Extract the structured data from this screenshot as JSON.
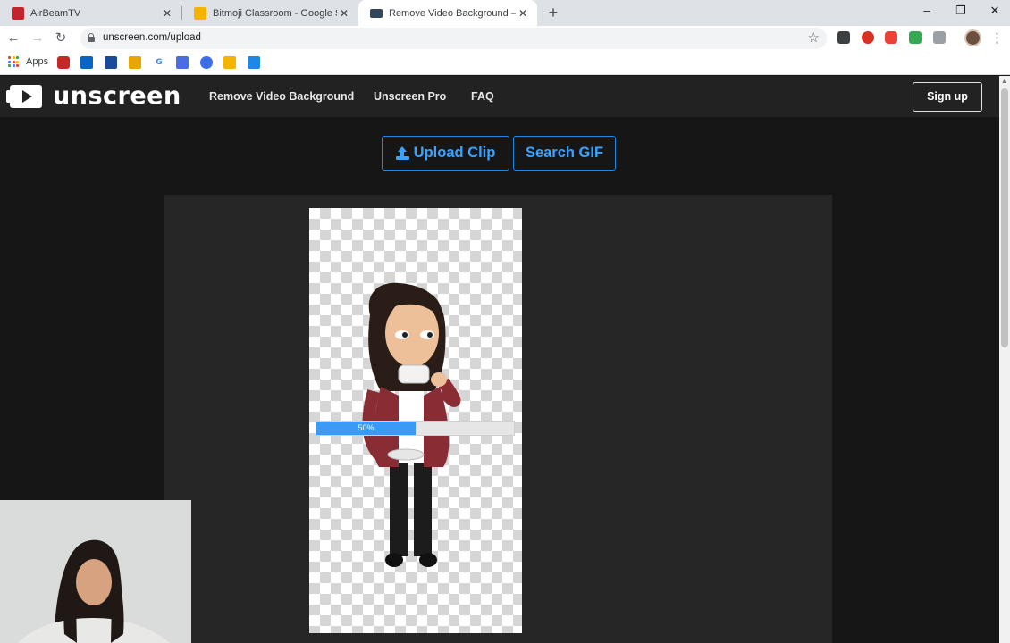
{
  "browser": {
    "tabs": [
      {
        "title": "AirBeamTV",
        "icon": "airbeam-icon",
        "color": "#c0272d",
        "active": false
      },
      {
        "title": "Bitmoji Classroom - Google Slides",
        "icon": "google-slides-icon",
        "color": "#f4b400",
        "active": false
      },
      {
        "title": "Remove Video Background – Unscreen",
        "icon": "unscreen-favicon",
        "color": "#33475b",
        "active": true
      }
    ],
    "url": "unscreen.com/upload",
    "bookmarks_label": "Apps"
  },
  "site": {
    "logo_text": "unscreen",
    "nav": [
      "Remove Video Background",
      "Unscreen Pro",
      "FAQ"
    ],
    "signup_label": "Sign up",
    "upload_label": "Upload Clip",
    "search_label": "Search GIF",
    "progress": {
      "value": 0.5,
      "label": "50%"
    }
  },
  "colors": {
    "accent": "#3aa3ff",
    "page_bg": "#161616",
    "header_bg": "#222222",
    "progress_fill": "#3a9af5"
  }
}
